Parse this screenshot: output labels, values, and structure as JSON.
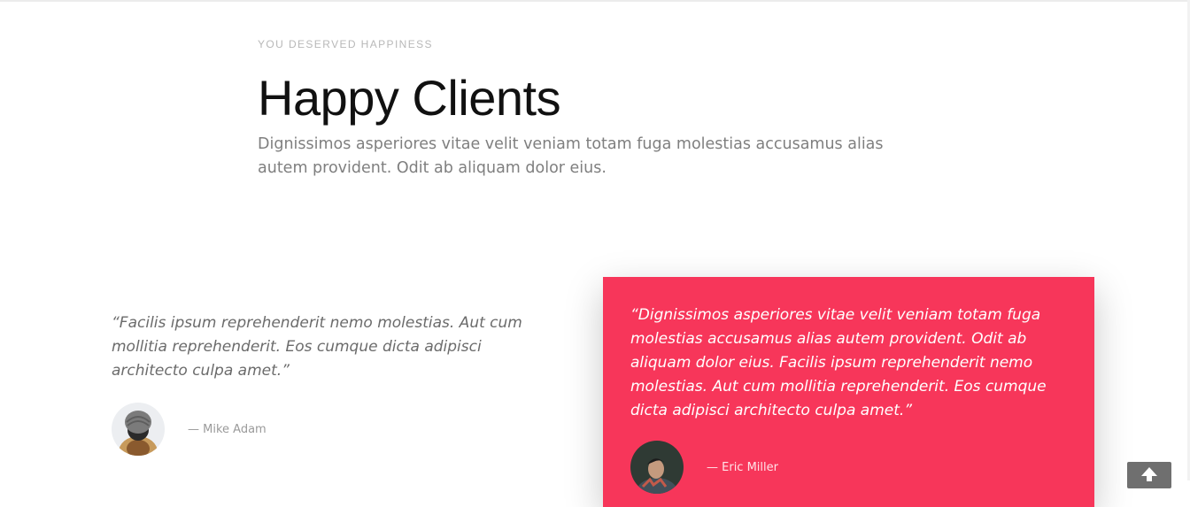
{
  "header": {
    "eyebrow": "YOU DESERVED HAPPINESS",
    "title": "Happy Clients",
    "lead": "Dignissimos asperiores vitae velit veniam totam fuga molestias accusamus alias autem provident. Odit ab aliquam dolor eius."
  },
  "testimonials": [
    {
      "quote": "“Facilis ipsum reprehenderit nemo molestias. Aut cum mollitia reprehenderit. Eos cumque dicta adipisci architecto culpa amet.”",
      "author": "— Mike Adam",
      "avatar": "person-in-knit-hat-avatar"
    },
    {
      "quote": "“Dignissimos asperiores vitae velit veniam totam fuga molestias accusamus alias autem provident. Odit ab aliquam dolor eius. Facilis ipsum reprehenderit nemo molestias. Aut cum mollitia reprehenderit. Eos cumque dicta adipisci architecto culpa amet.”",
      "author": "— Eric Miller",
      "avatar": "man-portrait-avatar",
      "highlight_color": "#f7365a"
    }
  ],
  "back_to_top": {
    "icon": "arrow-up-icon"
  }
}
